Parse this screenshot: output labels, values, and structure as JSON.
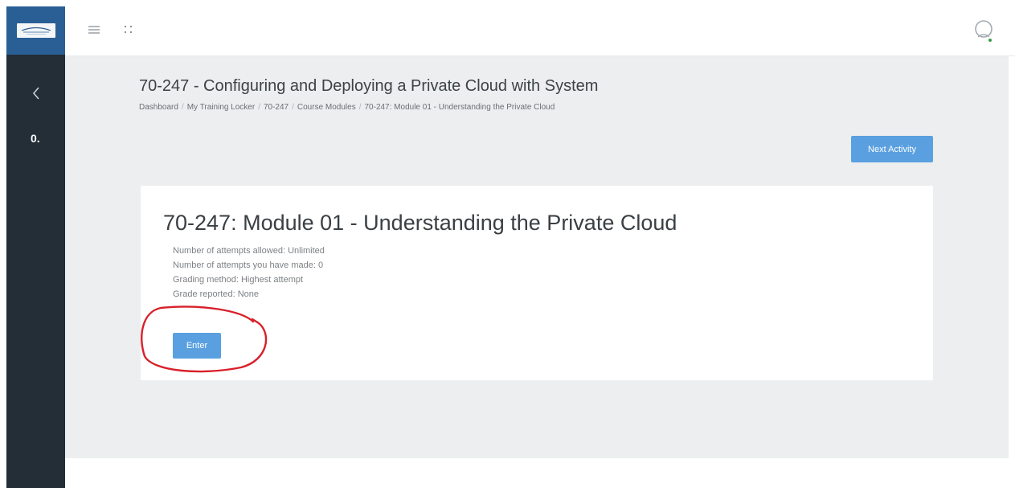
{
  "sidebar": {
    "logo_text": "NetScout",
    "back_icon": "chevron-left-icon",
    "number_label": "0."
  },
  "navbar": {
    "menu_icon": "hamburger-menu-icon",
    "apps_icon": "apps-grid-icon",
    "avatar_icon": "user-avatar-icon"
  },
  "header": {
    "title": "70-247 - Configuring and Deploying a Private Cloud with System",
    "breadcrumb": [
      "Dashboard",
      "My Training Locker",
      "70-247",
      "Course Modules",
      "70-247: Module 01 - Understanding the Private Cloud"
    ]
  },
  "actions": {
    "next_activity_label": "Next Activity"
  },
  "module": {
    "title": "70-247: Module 01 - Understanding the Private Cloud",
    "info": [
      "Number of attempts allowed: Unlimited",
      "Number of attempts you have made: 0",
      "Grading method: Highest attempt",
      "Grade reported: None"
    ],
    "enter_label": "Enter"
  },
  "colors": {
    "rail": "#232e37",
    "logo_bg": "#2a5f95",
    "button": "#5aa0e0",
    "content_bg": "#eceeef",
    "annotation": "#d8202a"
  }
}
